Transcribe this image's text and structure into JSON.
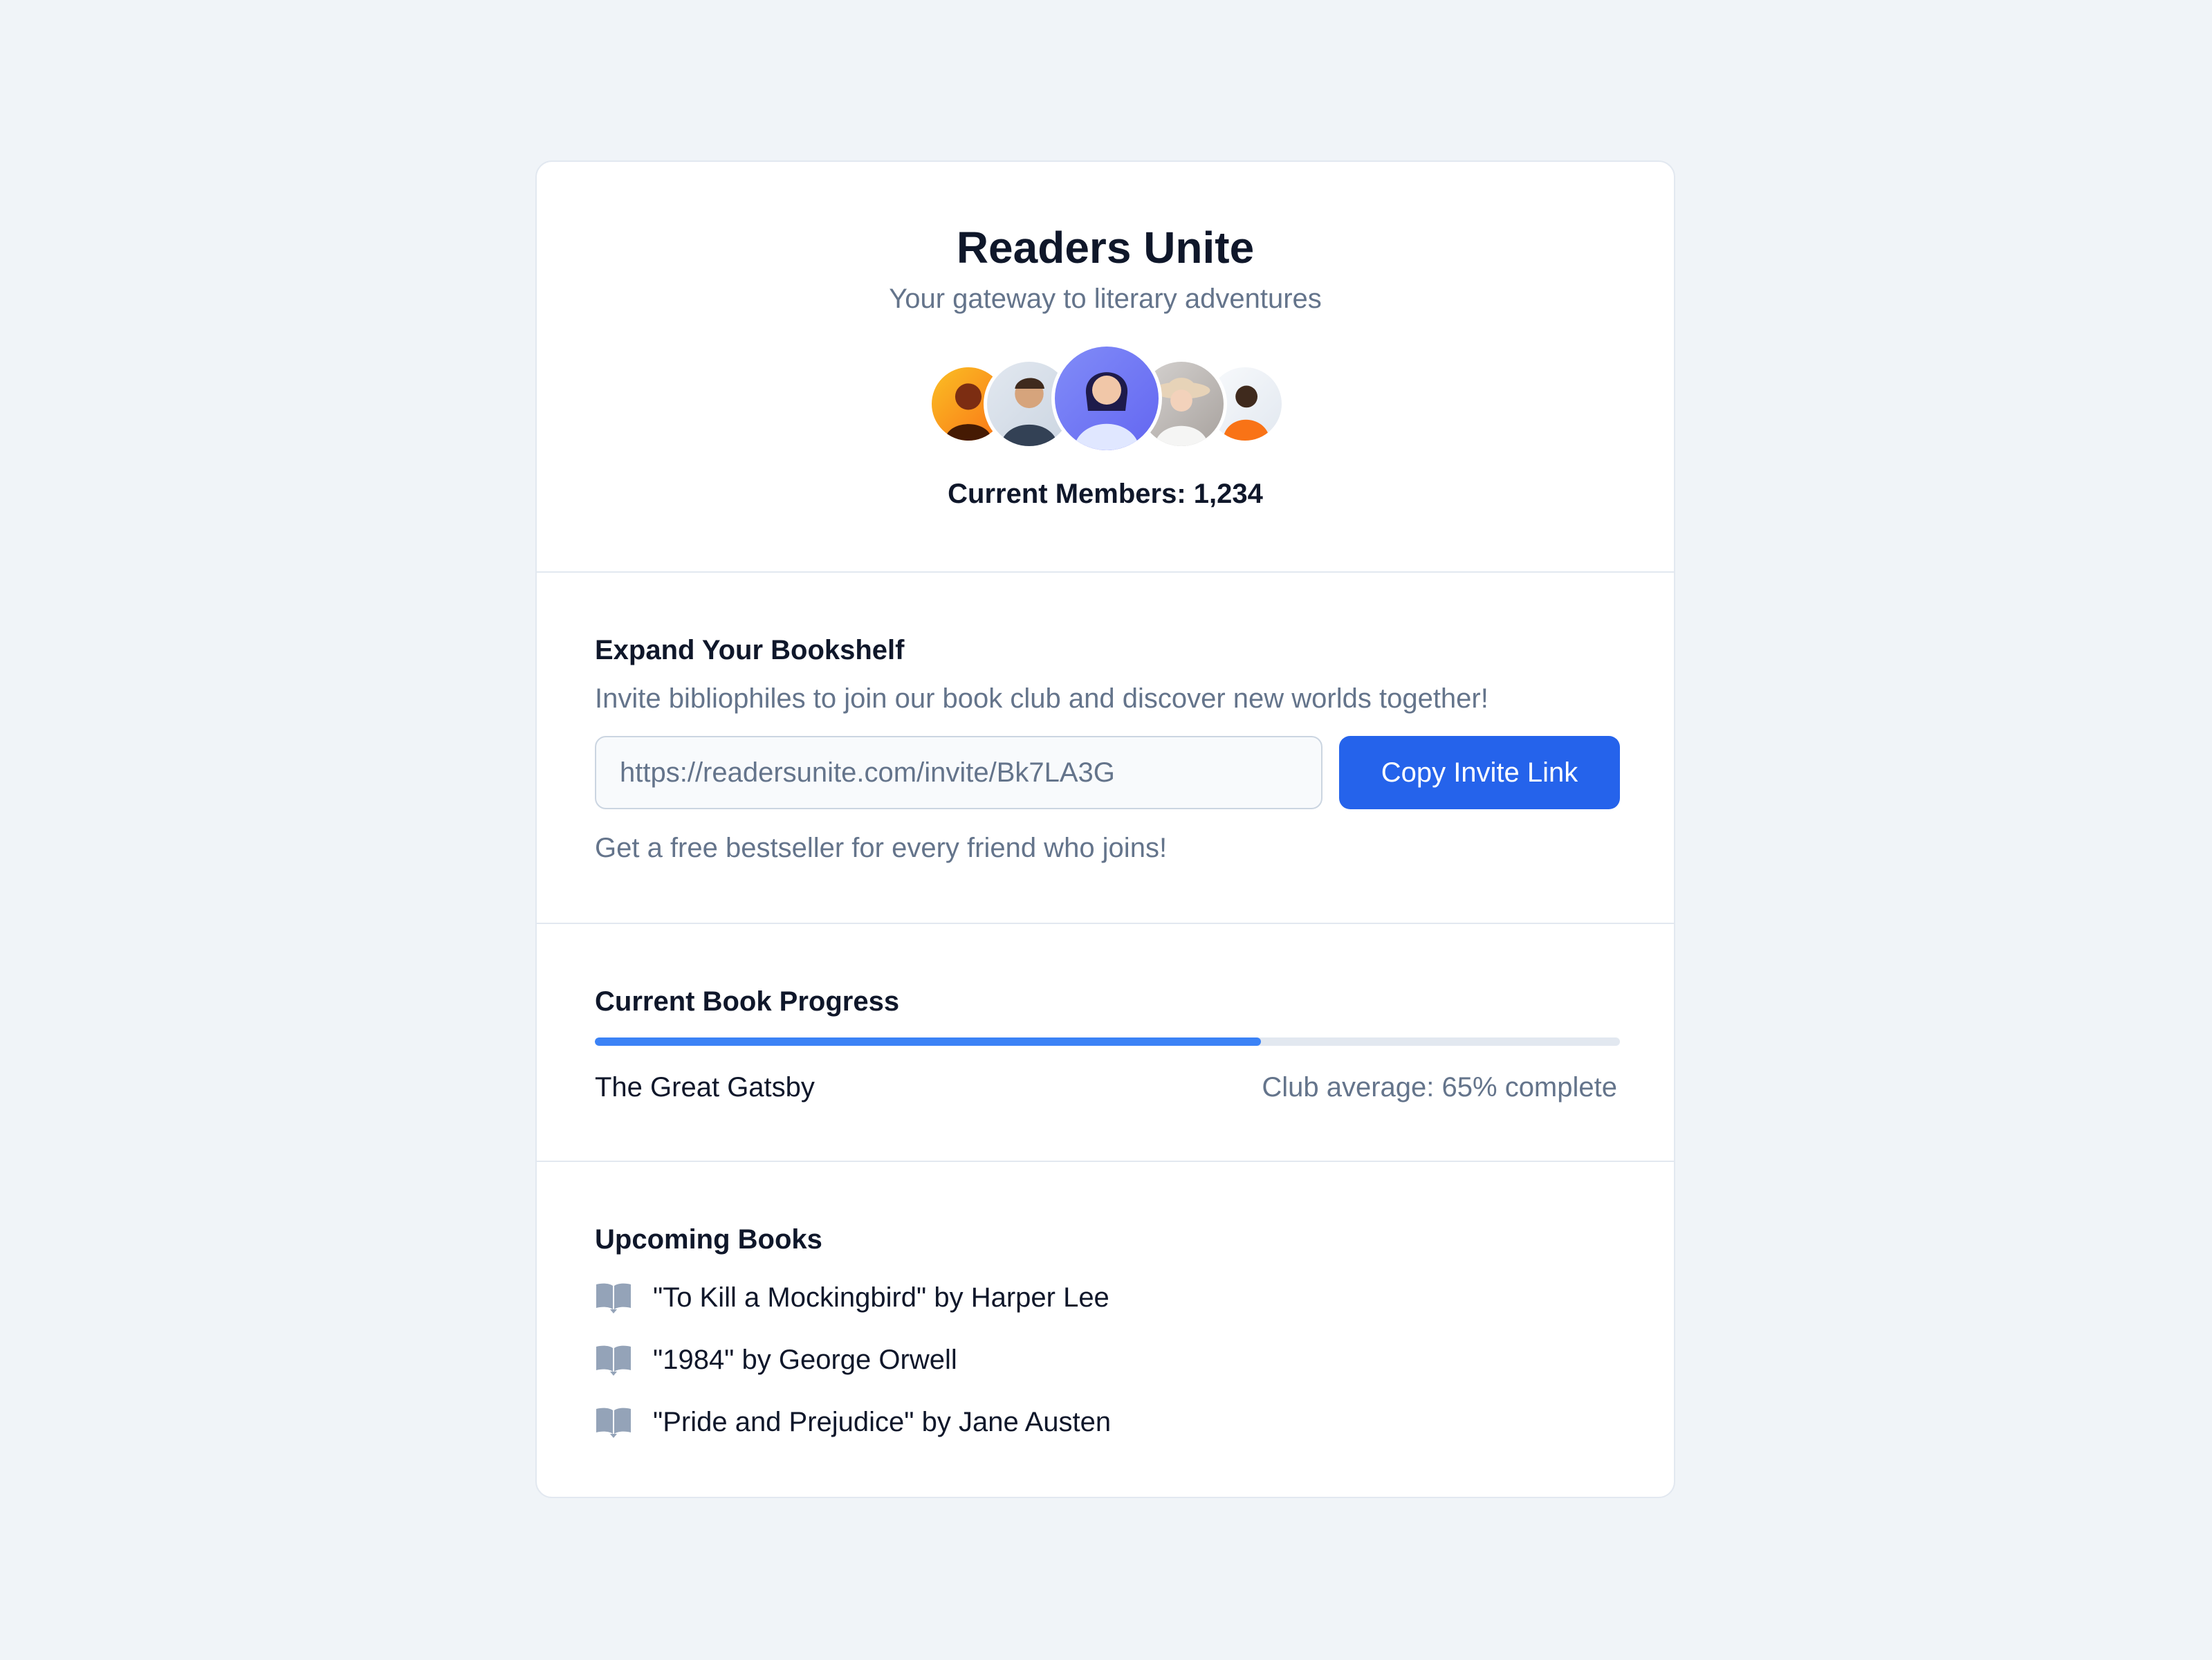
{
  "club": {
    "title": "Readers Unite",
    "tagline": "Your gateway to literary adventures",
    "members_text": "Current Members: 1,234",
    "avatars": [
      {
        "name": "member-avatar-1",
        "icon": "person-avatar",
        "bg": "#f59e0b"
      },
      {
        "name": "member-avatar-2",
        "icon": "person-avatar",
        "bg": "#cbd5e1"
      },
      {
        "name": "member-avatar-3",
        "icon": "person-avatar",
        "bg": "#6366f1"
      },
      {
        "name": "member-avatar-4",
        "icon": "person-avatar",
        "bg": "#a8a29e"
      },
      {
        "name": "member-avatar-5",
        "icon": "person-avatar",
        "bg": "#f97316"
      }
    ]
  },
  "invite": {
    "heading": "Expand Your Bookshelf",
    "description": "Invite bibliophiles to join our book club and discover new worlds together!",
    "link_value": "https://readersunite.com/invite/Bk7LA3G",
    "button_label": "Copy Invite Link",
    "reward_text": "Get a free bestseller for every friend who joins!"
  },
  "progress": {
    "heading": "Current Book Progress",
    "book": "The Great Gatsby",
    "status": "Club average: 65% complete",
    "percent": 65
  },
  "upcoming": {
    "heading": "Upcoming Books",
    "icon": "book-open-icon",
    "books": [
      "\"To Kill a Mockingbird\" by Harper Lee",
      "\"1984\" by George Orwell",
      "\"Pride and Prejudice\" by Jane Austen"
    ]
  },
  "colors": {
    "accent": "#2563eb",
    "progress_fill": "#3b82f6",
    "icon_gray": "#94a3b8",
    "background": "#f0f4f8"
  }
}
